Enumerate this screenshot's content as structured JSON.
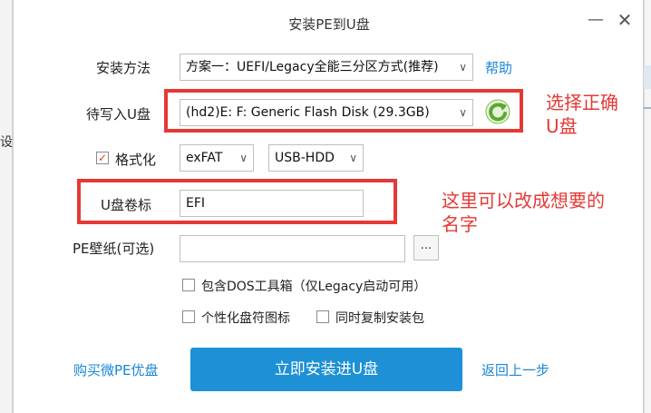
{
  "background": {
    "left_fragment_text": "设"
  },
  "dialog": {
    "title": "安装PE到U盘",
    "minimize_glyph": "—",
    "close_glyph": "✕"
  },
  "install_method": {
    "label": "安装方法",
    "value": "方案一：UEFI/Legacy全能三分区方式(推荐)",
    "help_link": "帮助"
  },
  "target_disk": {
    "label": "待写入U盘",
    "value": "(hd2)E: F: Generic Flash Disk (29.3GB)"
  },
  "format": {
    "label": "格式化",
    "checked": true,
    "filesystem": "exFAT",
    "mode": "USB-HDD"
  },
  "volume_label": {
    "label": "U盘卷标",
    "value": "EFI"
  },
  "wallpaper": {
    "label": "PE壁纸(可选)",
    "value": "",
    "browse_label": "..."
  },
  "options": {
    "dos_toolbox": "包含DOS工具箱（仅Legacy启动可用）",
    "personal_icon": "个性化盘符图标",
    "copy_installer": "同时复制安装包"
  },
  "footer": {
    "buy_link": "购买微PE优盘",
    "install_button": "立即安装进U盘",
    "back_link": "返回上一步"
  },
  "annotations": {
    "disk_note_line1": "选择正确",
    "disk_note_line2": "U盘",
    "label_note_line1": "这里可以改成想要的",
    "label_note_line2": "名字"
  },
  "colors": {
    "accent": "#1e90d6",
    "link": "#1a86d8",
    "annotation": "#e53935",
    "refresh": "#6db33f"
  }
}
